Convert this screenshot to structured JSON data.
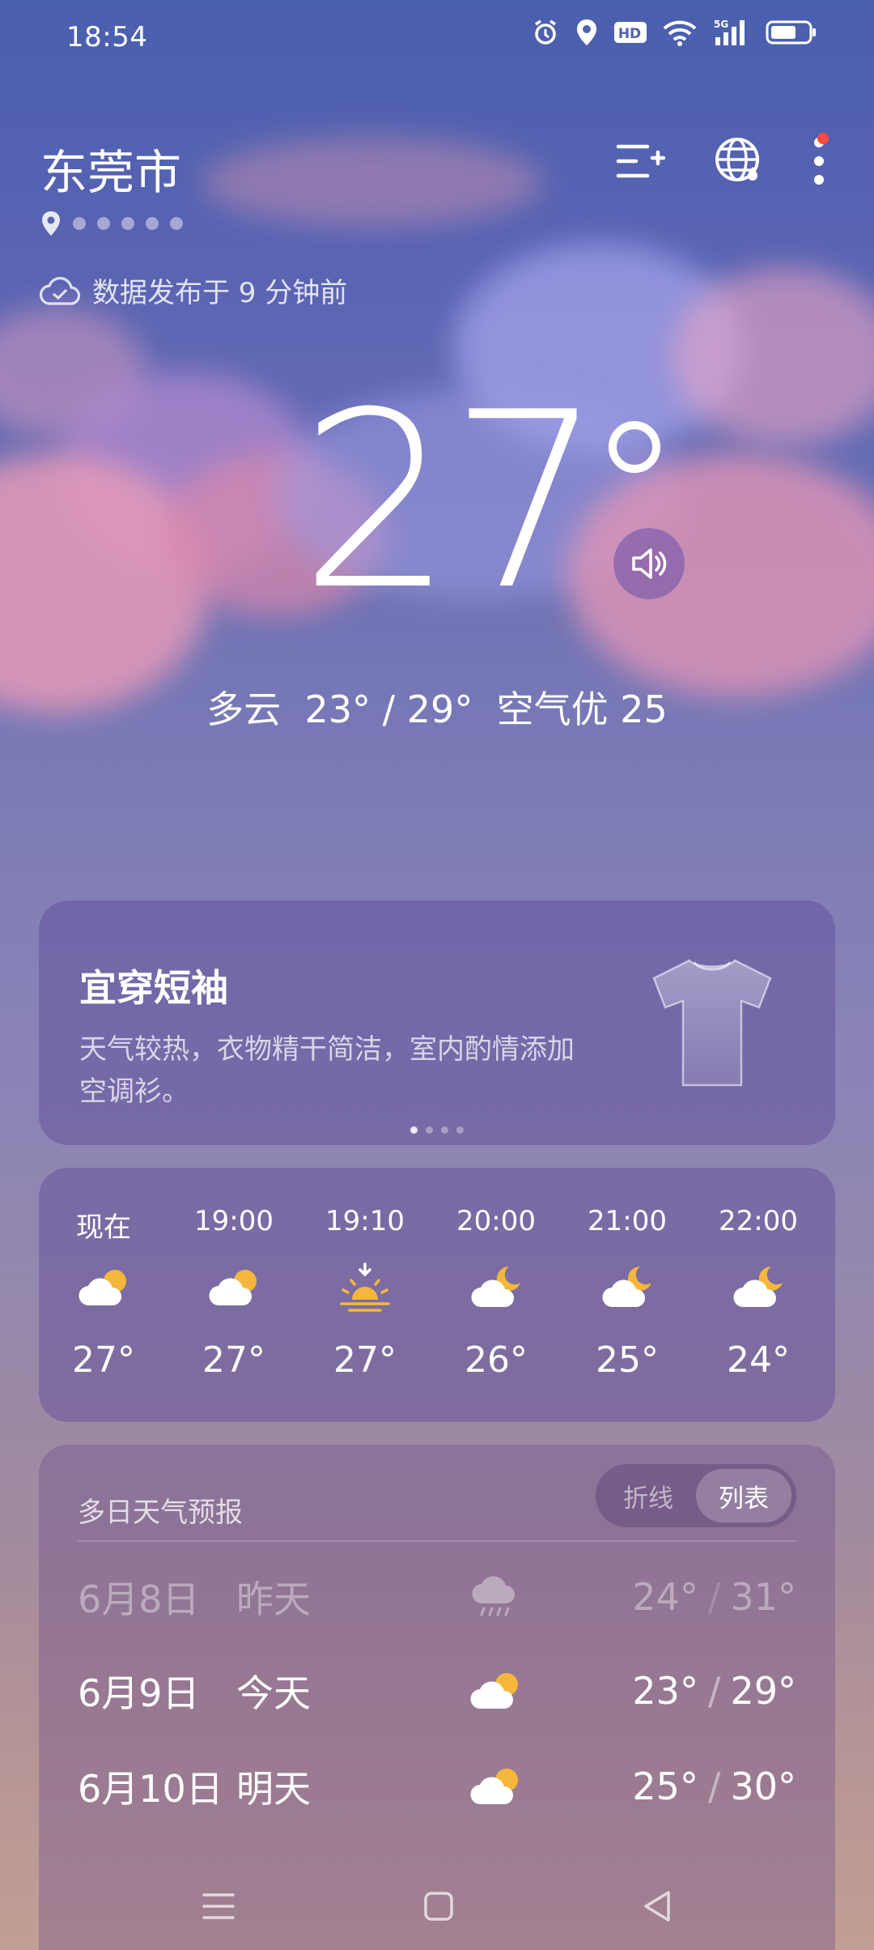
{
  "status": {
    "time": "18:54",
    "hd": "HD",
    "net": "5G"
  },
  "header": {
    "city": "东莞市",
    "published": "数据发布于 9 分钟前"
  },
  "current": {
    "temp": "27",
    "condition": "多云",
    "range": "23° / 29°",
    "air": "空气优 25"
  },
  "dressing": {
    "title": "宜穿短袖",
    "desc": "天气较热，衣物精干简洁，室内酌情添加空调衫。",
    "icon": "tshirt-icon"
  },
  "hourly": [
    {
      "time": "现在",
      "icon": "partly-cloudy-day-icon",
      "temp": "27°"
    },
    {
      "time": "19:00",
      "icon": "partly-cloudy-day-icon",
      "temp": "27°"
    },
    {
      "time": "19:10",
      "icon": "sunset-icon",
      "temp": "27°"
    },
    {
      "time": "20:00",
      "icon": "partly-cloudy-night-icon",
      "temp": "26°"
    },
    {
      "time": "21:00",
      "icon": "partly-cloudy-night-icon",
      "temp": "25°"
    },
    {
      "time": "22:00",
      "icon": "partly-cloudy-night-icon",
      "temp": "24°"
    }
  ],
  "forecast": {
    "title": "多日天气预报",
    "toggle": {
      "line": "折线",
      "list": "列表"
    },
    "days": [
      {
        "date": "6月8日",
        "day": "昨天",
        "icon": "rain-icon",
        "low": "24°",
        "high": "31°"
      },
      {
        "date": "6月9日",
        "day": "今天",
        "icon": "partly-cloudy-day-icon",
        "low": "23°",
        "high": "29°"
      },
      {
        "date": "6月10日",
        "day": "明天",
        "icon": "partly-cloudy-day-icon",
        "low": "25°",
        "high": "30°"
      }
    ]
  },
  "colors": {
    "accent_sun": "#f5b73b",
    "notify_dot": "#ff4a3d"
  }
}
